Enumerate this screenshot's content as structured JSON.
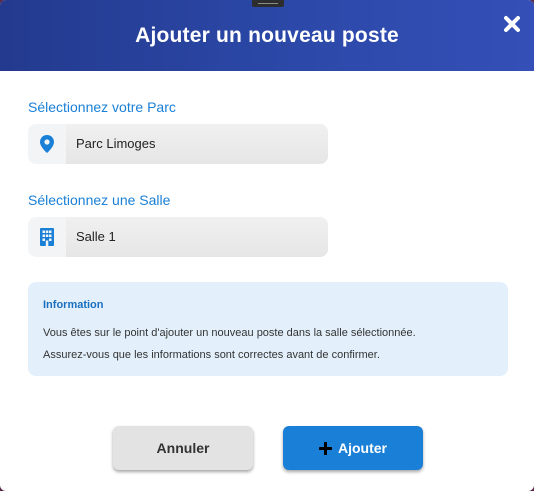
{
  "dialog": {
    "title": "Ajouter un nouveau poste"
  },
  "parc": {
    "label": "Sélectionnez votre Parc",
    "value": "Parc Limoges",
    "icon": "map-pin-icon"
  },
  "salle": {
    "label": "Sélectionnez une Salle",
    "value": "Salle 1",
    "icon": "building-icon"
  },
  "info": {
    "title": "Information",
    "line1": "Vous êtes sur le point d'ajouter un nouveau poste dans la salle sélectionnée.",
    "line2": "Assurez-vous que les informations sont correctes avant de confirmer."
  },
  "buttons": {
    "cancel": "Annuler",
    "add": "Ajouter"
  },
  "colors": {
    "header": "#2b47a6",
    "accent": "#1a7fd6",
    "info_bg": "#e3f0fb"
  }
}
